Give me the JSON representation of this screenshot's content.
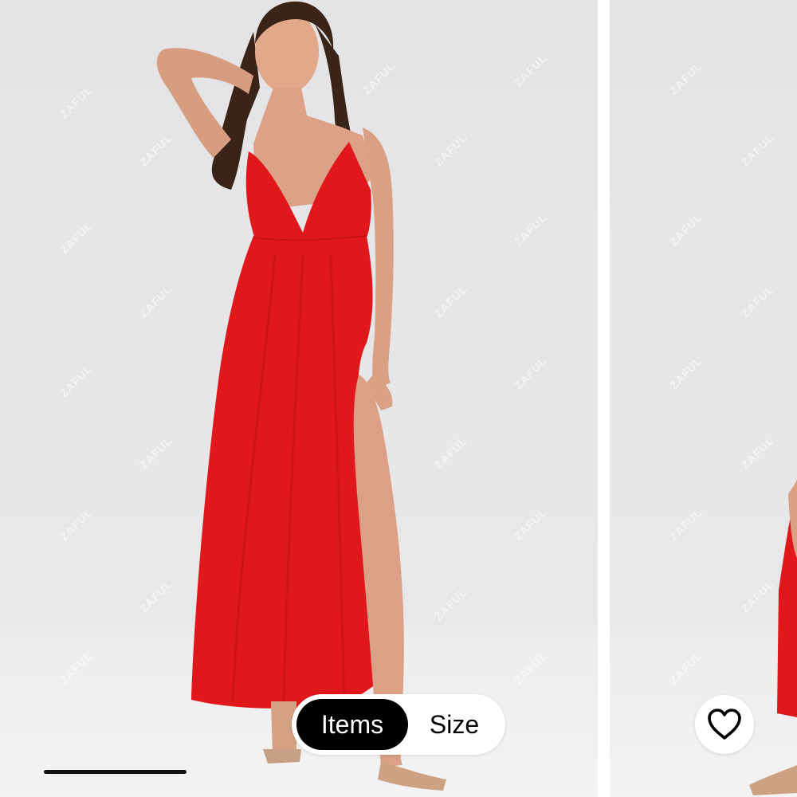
{
  "gallery": {
    "brand_watermark": "ZAFUL",
    "slides": [
      {
        "name": "red halter maxi dress front view"
      },
      {
        "name": "red halter maxi dress partial view"
      }
    ],
    "current_slide": 1,
    "slide_count": 2,
    "progress_fraction": 0.26
  },
  "view_toggle": {
    "options": [
      {
        "label": "Items",
        "selected": true
      },
      {
        "label": "Size",
        "selected": false
      }
    ]
  },
  "favorite": {
    "icon": "heart-outline-icon",
    "active": false
  },
  "colors": {
    "dress": "#e0171b",
    "toggle_selected_bg": "#000000",
    "toggle_selected_text": "#ffffff",
    "progress": "#111111"
  }
}
